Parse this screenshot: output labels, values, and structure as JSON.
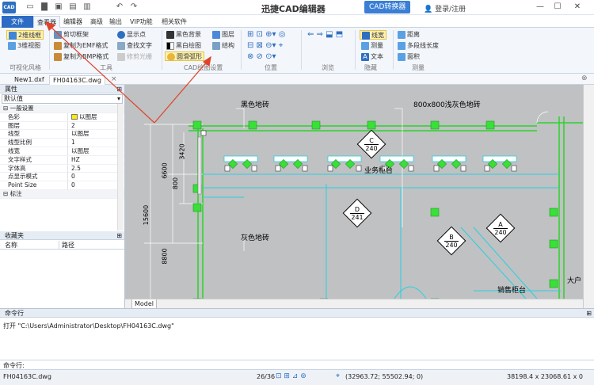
{
  "titlebar": {
    "app_icon": "CAD",
    "title": "迅捷CAD编辑器",
    "convert_button": "CAD转换器",
    "login": "登录/注册",
    "icons": [
      "new-icon",
      "open-icon",
      "save-icon",
      "print-icon",
      "undo-icon",
      "redo-icon"
    ]
  },
  "menu_tabs": [
    "文件",
    "查看器",
    "编辑器",
    "高级",
    "输出",
    "VIP功能",
    "相关软件"
  ],
  "ribbon": {
    "groups": {
      "visual_style": {
        "items": [
          "2维线框",
          "3维视图"
        ],
        "label": "可视化风格"
      },
      "tools": {
        "items": [
          "剪切框架",
          "复制为EMF格式",
          "复制为BMP格式",
          "显示点",
          "查找文字",
          "修剪光栅"
        ],
        "label": "工具"
      },
      "drawing_settings": {
        "items": [
          "黑色背景",
          "黑白绘图",
          "圆滑弧形",
          "图层",
          "结构"
        ],
        "label": "CAD绘图设置"
      },
      "position": {
        "label": "位置"
      },
      "browse": {
        "label": "浏览"
      },
      "hide": {
        "items": [
          "线宽",
          "测量",
          "文本"
        ],
        "label": "隐藏"
      },
      "measure": {
        "items": [
          "距离",
          "多段线长度",
          "面积"
        ],
        "label": "测量"
      }
    }
  },
  "doc_tabs": [
    "New1.dxf",
    "FH04163C.dwg"
  ],
  "properties": {
    "title": "属性",
    "select_value": "默认值",
    "category_general": "一般设置",
    "rows": [
      {
        "key": "色彩",
        "value": "以图层"
      },
      {
        "key": "图层",
        "value": "2"
      },
      {
        "key": "线型",
        "value": "以图层"
      },
      {
        "key": "线型比例",
        "value": "1"
      },
      {
        "key": "线宽",
        "value": "以图层"
      },
      {
        "key": "文字样式",
        "value": "HZ"
      },
      {
        "key": "字体高",
        "value": "2.5"
      },
      {
        "key": "点显示模式",
        "value": "0"
      },
      {
        "key": "Point Size",
        "value": "0"
      }
    ],
    "category_dim": "标注"
  },
  "favorites": {
    "title": "收藏夹",
    "col_name": "名称",
    "col_path": "路径"
  },
  "drawing": {
    "label_black_tile": "黑色地砖",
    "label_gray_tile_800": "800x800浅灰色地砖",
    "label_gray_tile": "灰色地砖",
    "label_business_desk": "业务柜台",
    "label_sales_desk": "销售柜台",
    "label_entry": "大户",
    "dims": [
      "3420",
      "800",
      "6600",
      "15600",
      "8800"
    ],
    "markers": [
      {
        "letter": "C",
        "num": "240"
      },
      {
        "letter": "D",
        "num": "241"
      },
      {
        "letter": "A",
        "num": "240"
      },
      {
        "letter": "B",
        "num": "240"
      }
    ],
    "model_tab": "Model"
  },
  "command": {
    "title": "命令行",
    "log": "打开 \"C:\\Users\\Administrator\\Desktop\\FH04163C.dwg\"",
    "prompt_label": "命令行:"
  },
  "status": {
    "file": "FH04163C.dwg",
    "page": "26/36",
    "coords": "(32963.72; 55502.94; 0)",
    "size": "38198.4 x 23068.61 x 0"
  },
  "colors": {
    "accent": "#2d6bc4",
    "drawing_bg": "#bfc1c3",
    "arrow": "#e0432a",
    "green": "#2bd42b",
    "cyan": "#28d0e0"
  }
}
